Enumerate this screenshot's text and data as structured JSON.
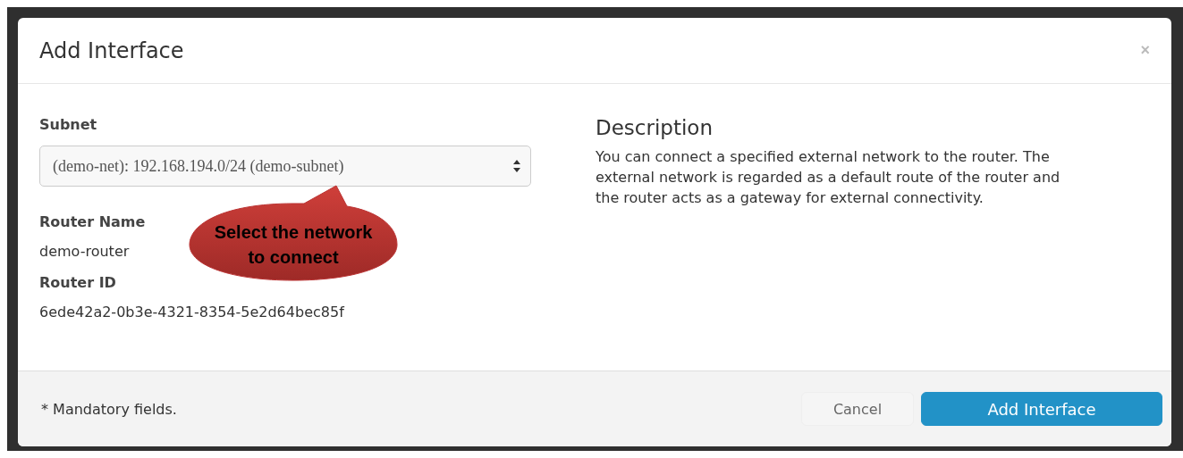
{
  "dialog": {
    "title": "Add Interface",
    "close": "×"
  },
  "form": {
    "subnet": {
      "label": "Subnet",
      "value": "(demo-net): 192.168.194.0/24 (demo-subnet)"
    },
    "fields": [
      {
        "label": "Router Name",
        "value": "demo-router"
      },
      {
        "label": "Router ID",
        "value": "6ede42a2-0b3e-4321-8354-5e2d64bec85f"
      }
    ]
  },
  "callout": {
    "text": "Select the network to connect"
  },
  "description": {
    "heading": "Description",
    "text": "You can connect a specified external network to the router. The external network is regarded as a default route of the router and the router acts as a gateway for external connectivity."
  },
  "footer": {
    "note": "* Mandatory fields.",
    "buttons": [
      {
        "label": "Cancel",
        "kind": "secondary"
      },
      {
        "label": "Add Interface",
        "kind": "primary"
      }
    ]
  }
}
